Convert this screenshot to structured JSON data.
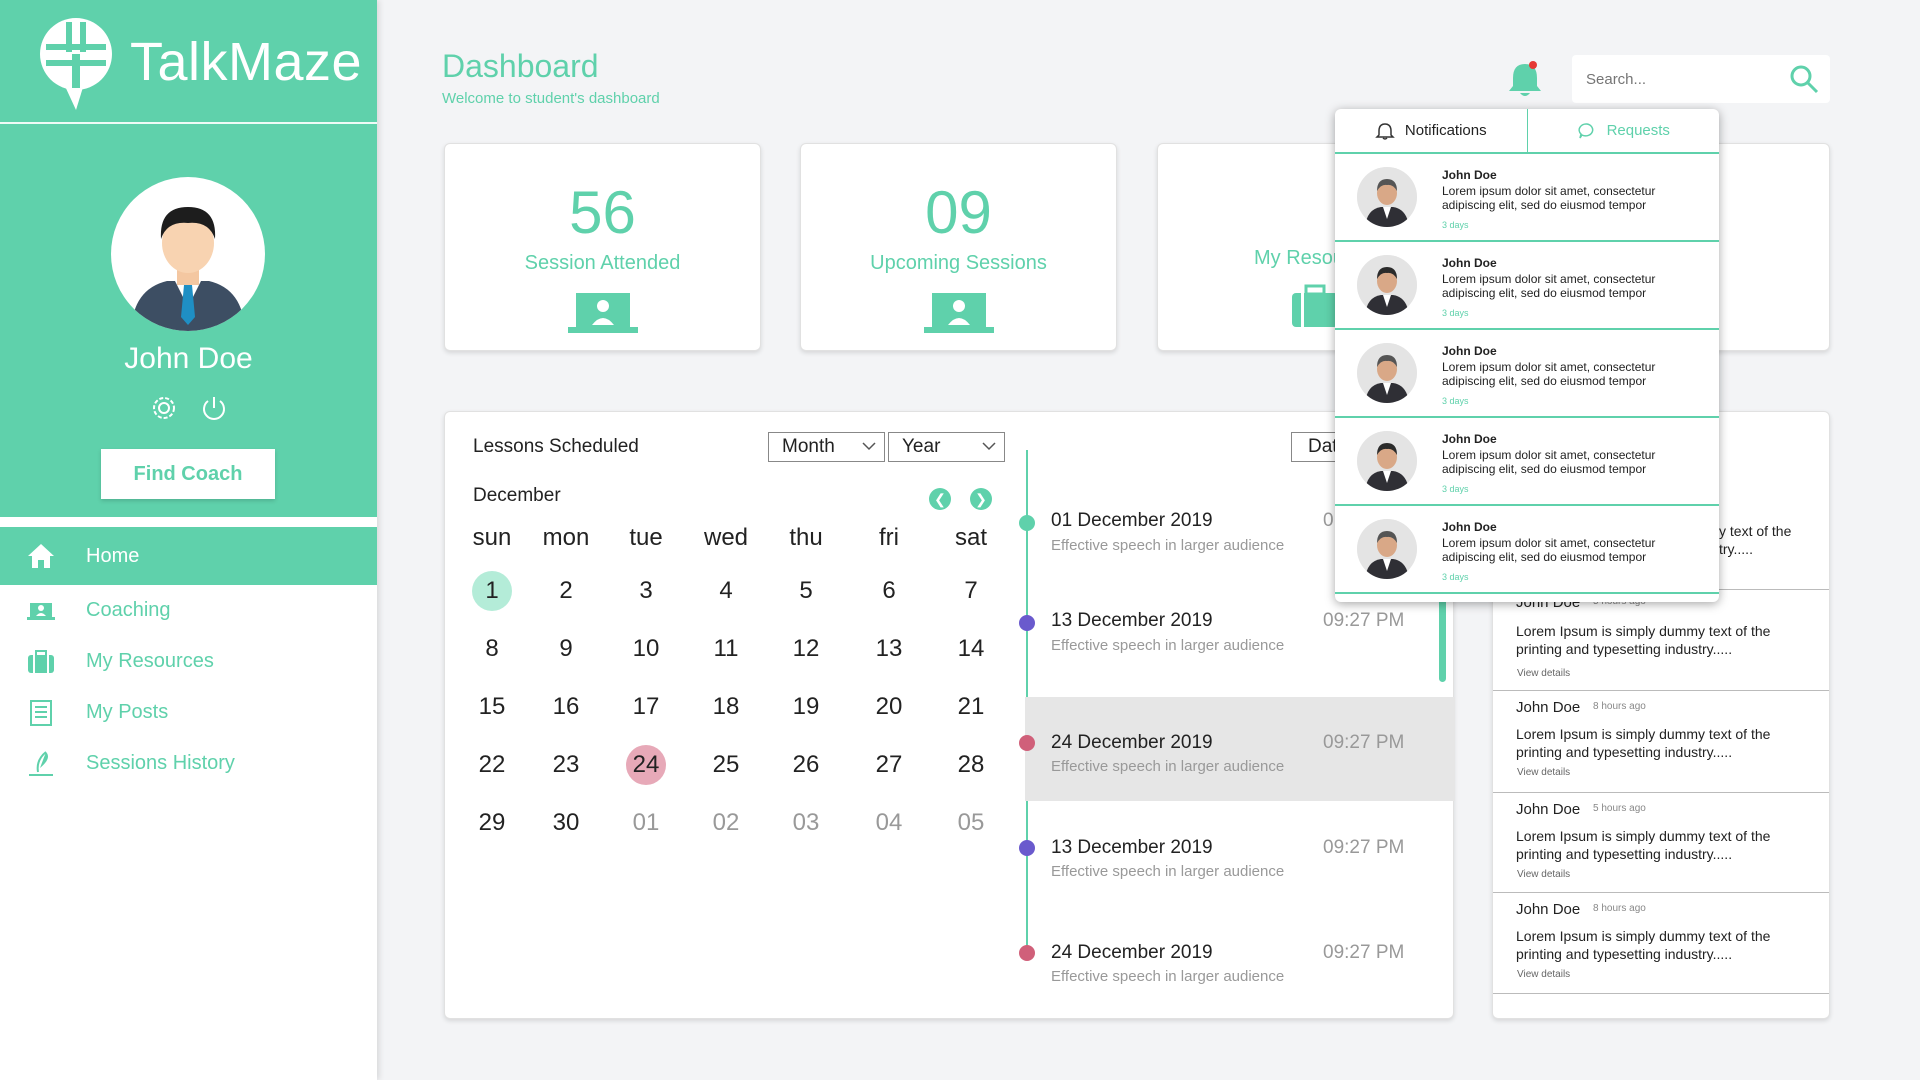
{
  "app": {
    "brand": "TalkMaze"
  },
  "profile": {
    "name": "John Doe",
    "cta": "Find Coach"
  },
  "nav": [
    {
      "label": "Home",
      "icon": "home-icon",
      "active": true
    },
    {
      "label": "Coaching",
      "icon": "coaching-icon"
    },
    {
      "label": "My Resources",
      "icon": "briefcase-icon"
    },
    {
      "label": "My Posts",
      "icon": "posts-icon"
    },
    {
      "label": "Sessions History",
      "icon": "history-icon"
    }
  ],
  "header": {
    "title": "Dashboard",
    "subtitle": "Welcome to student's dashboard",
    "search_placeholder": "Search..."
  },
  "stats": [
    {
      "value": "56",
      "label": "Session Attended"
    },
    {
      "value": "09",
      "label": "Upcoming Sessions"
    },
    {
      "value": "",
      "label": "My Resou"
    }
  ],
  "calendar": {
    "title": "Lessons Scheduled",
    "month_select": "Month",
    "year_select": "Year",
    "month_name": "December",
    "weekdays": [
      "sun",
      "mon",
      "tue",
      "wed",
      "thu",
      "fri",
      "sat"
    ],
    "days": [
      "1",
      "2",
      "3",
      "4",
      "5",
      "6",
      "7",
      "8",
      "9",
      "10",
      "11",
      "12",
      "13",
      "14",
      "15",
      "16",
      "17",
      "18",
      "19",
      "20",
      "21",
      "22",
      "23",
      "24",
      "25",
      "26",
      "27",
      "28",
      "29",
      "30",
      "01",
      "02",
      "03",
      "04",
      "05"
    ],
    "today": "1",
    "selected": "24"
  },
  "date_button": "Dat",
  "timeline": [
    {
      "date": "01 December 2019",
      "time": "0",
      "desc": "Effective speech in larger audience",
      "color": "#5fd1ab"
    },
    {
      "date": "13 December 2019",
      "time": "09:27 PM",
      "desc": "Effective speech in larger audience",
      "color": "#6a5acd"
    },
    {
      "date": "24 December 2019",
      "time": "09:27 PM",
      "desc": "Effective speech in larger audience",
      "color": "#d0607a"
    },
    {
      "date": "13 December 2019",
      "time": "09:27 PM",
      "desc": "Effective speech in larger audience",
      "color": "#6a5acd"
    },
    {
      "date": "24 December 2019",
      "time": "09:27 PM",
      "desc": "Effective speech in larger audience",
      "color": "#d0607a"
    }
  ],
  "feed": {
    "partial_top_line1": "y text of the",
    "partial_top_line2": "try.....",
    "partial_name": "John Doe",
    "partial_time": "5 hours ago",
    "items": [
      {
        "name": "John Doe",
        "time": "5 hours ago",
        "text": "Lorem Ipsum is simply dummy text of the printing and typesetting industry.....",
        "link": "View details"
      },
      {
        "name": "John Doe",
        "time": "8 hours ago",
        "text": "Lorem Ipsum is simply dummy text of the printing and typesetting industry.....",
        "link": "View details"
      },
      {
        "name": "John Doe",
        "time": "5 hours ago",
        "text": "Lorem Ipsum is simply dummy text of the printing and typesetting industry.....",
        "link": "View details"
      },
      {
        "name": "John Doe",
        "time": "8 hours ago",
        "text": "Lorem Ipsum is simply dummy text of the printing and typesetting industry.....",
        "link": "View details"
      }
    ]
  },
  "notifications": {
    "tab_active": "Notifications",
    "tab_inactive": "Requests",
    "items": [
      {
        "name": "John Doe",
        "text": "Lorem ipsum dolor sit amet, consectetur adipiscing elit, sed do eiusmod tempor",
        "time": "3 days"
      },
      {
        "name": "John Doe",
        "text": "Lorem ipsum dolor sit amet, consectetur adipiscing elit, sed do eiusmod tempor",
        "time": "3 days"
      },
      {
        "name": "John Doe",
        "text": "Lorem ipsum dolor sit amet, consectetur adipiscing elit, sed do eiusmod tempor",
        "time": "3 days"
      },
      {
        "name": "John Doe",
        "text": "Lorem ipsum dolor sit amet, consectetur adipiscing elit, sed do eiusmod tempor",
        "time": "3 days"
      },
      {
        "name": "John Doe",
        "text": "Lorem ipsum dolor sit amet, consectetur adipiscing elit, sed do eiusmod tempor",
        "time": "3 days"
      }
    ]
  },
  "colors": {
    "accent": "#5fd1ab",
    "purple": "#6a5acd",
    "pink": "#d0607a"
  }
}
